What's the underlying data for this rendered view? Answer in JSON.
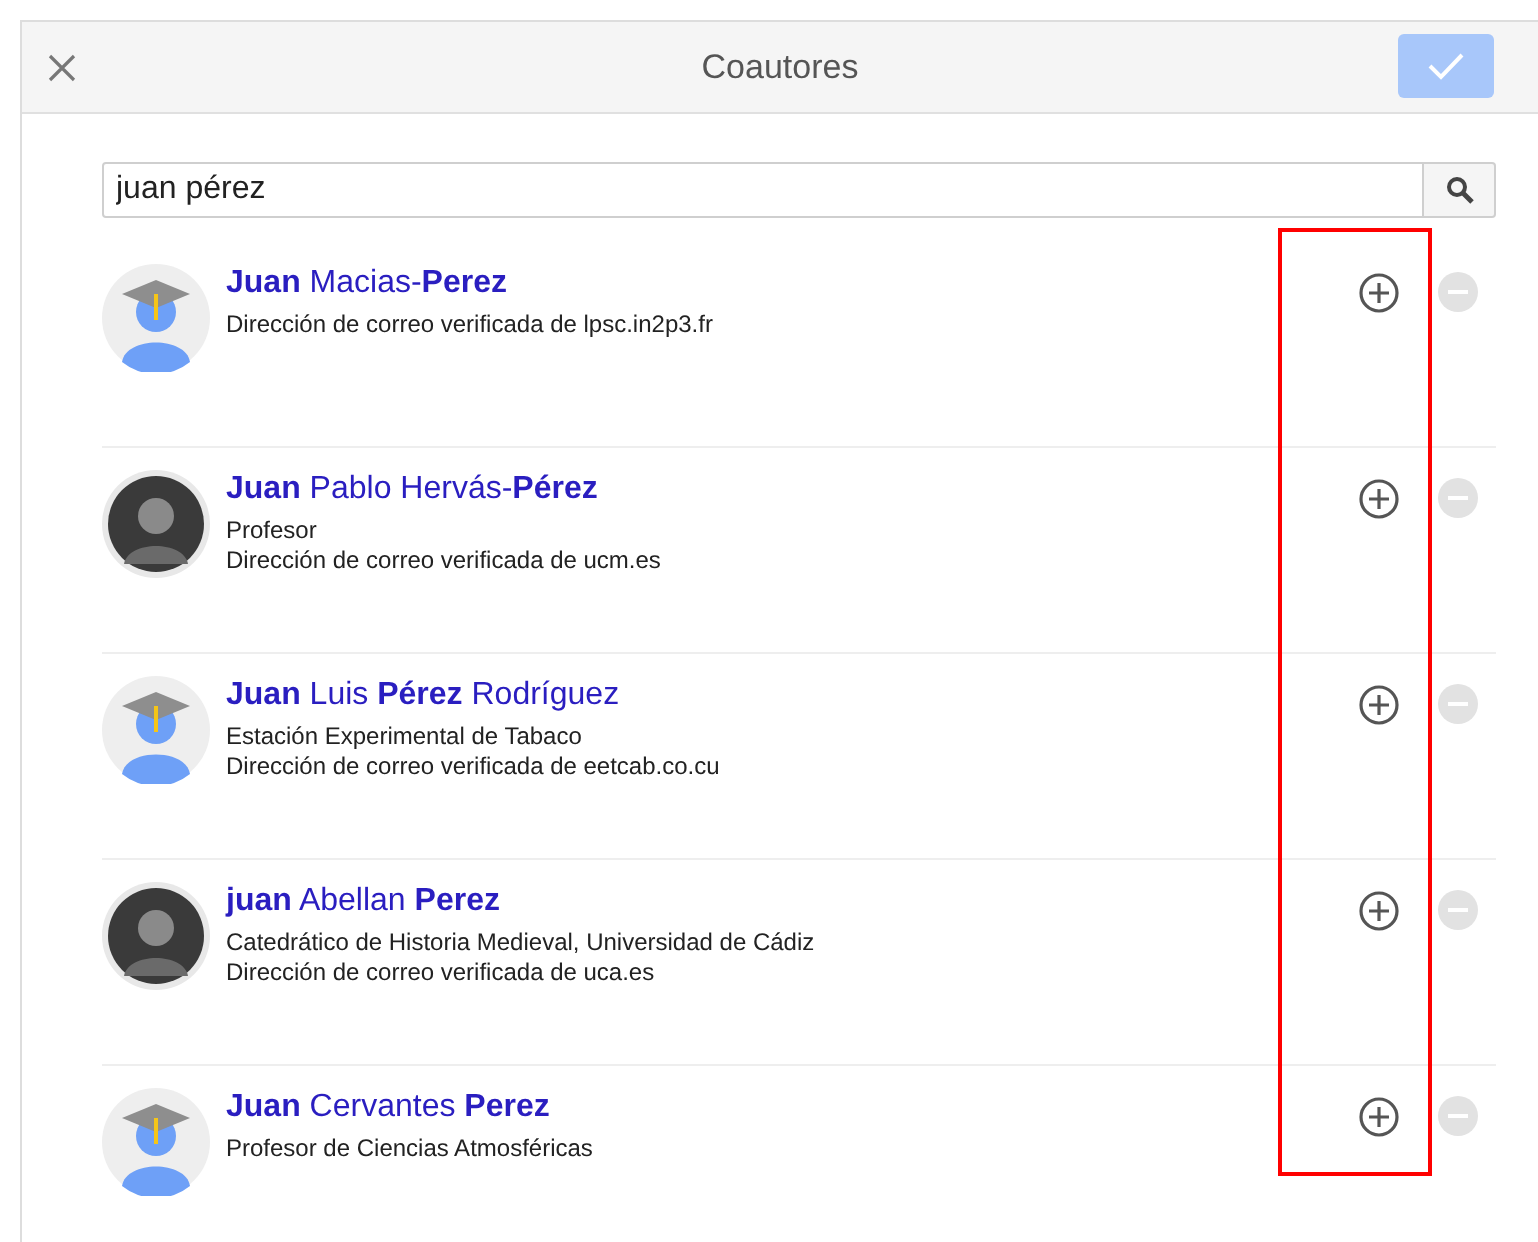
{
  "dialog": {
    "title": "Coautores",
    "confirm_disabled": true
  },
  "search": {
    "value": "juan pérez"
  },
  "results": [
    {
      "name": "**Juan** Macias-**Perez**",
      "kind": "default",
      "lines": [
        "Dirección de correo verificada de lpsc.in2p3.fr"
      ],
      "remove_disabled": true
    },
    {
      "name": "**Juan** Pablo Hervás-**Pérez**",
      "kind": "photo",
      "lines": [
        "Profesor",
        "Dirección de correo verificada de ucm.es"
      ],
      "remove_disabled": true
    },
    {
      "name": "**Juan** Luis **Pérez** Rodríguez",
      "kind": "default",
      "lines": [
        "Estación Experimental de Tabaco",
        "Dirección de correo verificada de eetcab.co.cu"
      ],
      "remove_disabled": true
    },
    {
      "name": "**juan** Abellan **Perez**",
      "kind": "photo",
      "lines": [
        "Catedrático de Historia Medieval, Universidad de Cádiz",
        "Dirección de correo verificada de uca.es"
      ],
      "remove_disabled": true
    },
    {
      "name": "**Juan** Cervantes **Perez**",
      "kind": "default",
      "lines": [
        "Profesor de Ciencias Atmosféricas"
      ],
      "remove_disabled": true
    }
  ],
  "annotation": {
    "highlight": true
  }
}
